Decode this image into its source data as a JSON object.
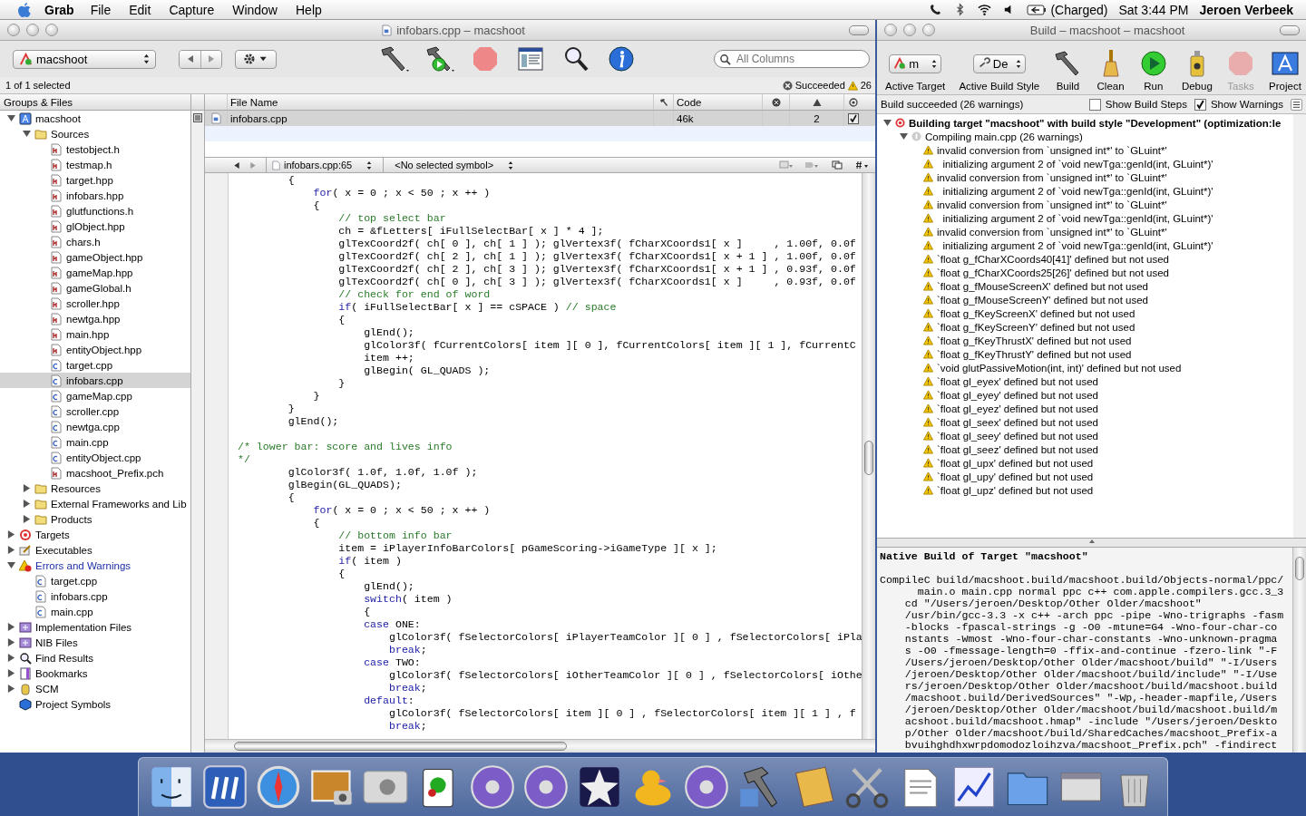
{
  "menu_bar": {
    "app_name": "Grab",
    "menus": [
      "File",
      "Edit",
      "Capture",
      "Window",
      "Help"
    ],
    "battery": "(Charged)",
    "clock": "Sat 3:44 PM",
    "user": "Jeroen Verbeek"
  },
  "project_window": {
    "title": "infobars.cpp – macshoot",
    "target_popup": "macshoot",
    "search": {
      "placeholder": "All Columns"
    },
    "selection_status": "1 of 1 selected",
    "build_status": "Succeeded",
    "warning_count": "26",
    "sidebar": {
      "header": "Groups & Files",
      "items": [
        {
          "label": "macshoot",
          "kind": "project",
          "expanded": true,
          "selected": false,
          "children": [
            {
              "label": "Sources",
              "kind": "folder",
              "expanded": true,
              "selected": false,
              "children": [
                {
                  "label": "testobject.h",
                  "kind": "header",
                  "selected": false
                },
                {
                  "label": "testmap.h",
                  "kind": "header",
                  "selected": false
                },
                {
                  "label": "target.hpp",
                  "kind": "header",
                  "selected": false
                },
                {
                  "label": "infobars.hpp",
                  "kind": "header",
                  "selected": false
                },
                {
                  "label": "glutfunctions.h",
                  "kind": "header",
                  "selected": false
                },
                {
                  "label": "glObject.hpp",
                  "kind": "header",
                  "selected": false
                },
                {
                  "label": "chars.h",
                  "kind": "header",
                  "selected": false
                },
                {
                  "label": "gameObject.hpp",
                  "kind": "header",
                  "selected": false
                },
                {
                  "label": "gameMap.hpp",
                  "kind": "header",
                  "selected": false
                },
                {
                  "label": "gameGlobal.h",
                  "kind": "header",
                  "selected": false
                },
                {
                  "label": "scroller.hpp",
                  "kind": "header",
                  "selected": false
                },
                {
                  "label": "newtga.hpp",
                  "kind": "header",
                  "selected": false
                },
                {
                  "label": "main.hpp",
                  "kind": "header",
                  "selected": false
                },
                {
                  "label": "entityObject.hpp",
                  "kind": "header",
                  "selected": false
                },
                {
                  "label": "target.cpp",
                  "kind": "cpp",
                  "selected": false
                },
                {
                  "label": "infobars.cpp",
                  "kind": "cpp",
                  "selected": true
                },
                {
                  "label": "gameMap.cpp",
                  "kind": "cpp",
                  "selected": false
                },
                {
                  "label": "scroller.cpp",
                  "kind": "cpp",
                  "selected": false
                },
                {
                  "label": "newtga.cpp",
                  "kind": "cpp",
                  "selected": false
                },
                {
                  "label": "main.cpp",
                  "kind": "cpp",
                  "selected": false
                },
                {
                  "label": "entityObject.cpp",
                  "kind": "cpp",
                  "selected": false
                },
                {
                  "label": "macshoot_Prefix.pch",
                  "kind": "header",
                  "selected": false
                }
              ]
            },
            {
              "label": "Resources",
              "kind": "folder",
              "expanded": false,
              "selected": false
            },
            {
              "label": "External Frameworks and Lib",
              "kind": "folder",
              "expanded": false,
              "selected": false
            },
            {
              "label": "Products",
              "kind": "folder",
              "expanded": false,
              "selected": false
            }
          ]
        },
        {
          "label": "Targets",
          "kind": "target",
          "expanded": false,
          "selected": false
        },
        {
          "label": "Executables",
          "kind": "executable",
          "expanded": false,
          "selected": false
        },
        {
          "label": "Errors and Warnings",
          "kind": "warning",
          "expanded": true,
          "selected": false,
          "children": [
            {
              "label": "target.cpp",
              "kind": "cpp",
              "selected": false
            },
            {
              "label": "infobars.cpp",
              "kind": "cpp",
              "selected": false
            },
            {
              "label": "main.cpp",
              "kind": "cpp",
              "selected": false
            }
          ]
        },
        {
          "label": "Implementation Files",
          "kind": "smart_group",
          "expanded": false,
          "selected": false
        },
        {
          "label": "NIB Files",
          "kind": "smart_group",
          "expanded": false,
          "selected": false
        },
        {
          "label": "Find Results",
          "kind": "find",
          "expanded": false,
          "selected": false
        },
        {
          "label": "Bookmarks",
          "kind": "bookmark",
          "expanded": false,
          "selected": false
        },
        {
          "label": "SCM",
          "kind": "scm",
          "expanded": false,
          "selected": false
        },
        {
          "label": "Project Symbols",
          "kind": "symbols",
          "selected": false
        }
      ]
    },
    "file_table": {
      "columns": [
        "File Name",
        "Code"
      ],
      "rows": [
        {
          "file": "infobars.cpp",
          "code": "46k",
          "warnings": "2",
          "checked": true,
          "selected": true
        }
      ]
    },
    "editor": {
      "file_position": "infobars.cpp:65",
      "symbol": "<No selected symbol>",
      "lines": [
        {
          "kind": "code",
          "segments": [
            {
              "kind": "plain",
              "text": "        {"
            }
          ]
        },
        {
          "kind": "code",
          "segments": [
            {
              "kind": "keyword",
              "text": "            for"
            },
            {
              "kind": "plain",
              "text": "( x = 0 ; x < 50 ; x ++ )"
            }
          ]
        },
        {
          "kind": "code",
          "segments": [
            {
              "kind": "plain",
              "text": "            {"
            }
          ]
        },
        {
          "kind": "code",
          "segments": [
            {
              "kind": "comment",
              "text": "                // top select bar"
            }
          ]
        },
        {
          "kind": "code",
          "segments": [
            {
              "kind": "plain",
              "text": "                ch = &fLetters[ iFullSelectBar[ x ] * 4 ];"
            }
          ]
        },
        {
          "kind": "code",
          "segments": [
            {
              "kind": "plain",
              "text": "                glTexCoord2f( ch[ 0 ], ch[ 1 ] ); glVertex3f( fCharXCoords1[ x ]     , 1.00f, 0.0f"
            }
          ]
        },
        {
          "kind": "code",
          "segments": [
            {
              "kind": "plain",
              "text": "                glTexCoord2f( ch[ 2 ], ch[ 1 ] ); glVertex3f( fCharXCoords1[ x + 1 ] , 1.00f, 0.0f"
            }
          ]
        },
        {
          "kind": "code",
          "segments": [
            {
              "kind": "plain",
              "text": "                glTexCoord2f( ch[ 2 ], ch[ 3 ] ); glVertex3f( fCharXCoords1[ x + 1 ] , 0.93f, 0.0f"
            }
          ]
        },
        {
          "kind": "code",
          "segments": [
            {
              "kind": "plain",
              "text": "                glTexCoord2f( ch[ 0 ], ch[ 3 ] ); glVertex3f( fCharXCoords1[ x ]     , 0.93f, 0.0f"
            }
          ]
        },
        {
          "kind": "code",
          "segments": [
            {
              "kind": "comment",
              "text": "                // check for end of word"
            }
          ]
        },
        {
          "kind": "code",
          "segments": [
            {
              "kind": "keyword",
              "text": "                if"
            },
            {
              "kind": "plain",
              "text": "( iFullSelectBar[ x ] == cSPACE ) "
            },
            {
              "kind": "comment",
              "text": "// space"
            }
          ]
        },
        {
          "kind": "code",
          "segments": [
            {
              "kind": "plain",
              "text": "                {"
            }
          ]
        },
        {
          "kind": "code",
          "segments": [
            {
              "kind": "plain",
              "text": "                    glEnd();"
            }
          ]
        },
        {
          "kind": "code",
          "segments": [
            {
              "kind": "plain",
              "text": "                    glColor3f( fCurrentColors[ item ][ 0 ], fCurrentColors[ item ][ 1 ], fCurrentC"
            }
          ]
        },
        {
          "kind": "code",
          "segments": [
            {
              "kind": "plain",
              "text": "                    item ++;"
            }
          ]
        },
        {
          "kind": "code",
          "segments": [
            {
              "kind": "plain",
              "text": "                    glBegin( GL_QUADS );"
            }
          ]
        },
        {
          "kind": "code",
          "segments": [
            {
              "kind": "plain",
              "text": "                }"
            }
          ]
        },
        {
          "kind": "code",
          "segments": [
            {
              "kind": "plain",
              "text": "            }"
            }
          ]
        },
        {
          "kind": "code",
          "segments": [
            {
              "kind": "plain",
              "text": "        }"
            }
          ]
        },
        {
          "kind": "code",
          "segments": [
            {
              "kind": "plain",
              "text": "        glEnd();"
            }
          ]
        },
        {
          "kind": "blank"
        },
        {
          "kind": "code",
          "segments": [
            {
              "kind": "comment",
              "text": "/* lower bar: score and lives info"
            }
          ]
        },
        {
          "kind": "code",
          "segments": [
            {
              "kind": "comment",
              "text": "*/"
            }
          ]
        },
        {
          "kind": "code",
          "segments": [
            {
              "kind": "plain",
              "text": "        glColor3f( 1.0f, 1.0f, 1.0f );"
            }
          ]
        },
        {
          "kind": "code",
          "segments": [
            {
              "kind": "plain",
              "text": "        glBegin(GL_QUADS);"
            }
          ]
        },
        {
          "kind": "code",
          "segments": [
            {
              "kind": "plain",
              "text": "        {"
            }
          ]
        },
        {
          "kind": "code",
          "segments": [
            {
              "kind": "keyword",
              "text": "            for"
            },
            {
              "kind": "plain",
              "text": "( x = 0 ; x < 50 ; x ++ )"
            }
          ]
        },
        {
          "kind": "code",
          "segments": [
            {
              "kind": "plain",
              "text": "            {"
            }
          ]
        },
        {
          "kind": "code",
          "segments": [
            {
              "kind": "comment",
              "text": "                // bottom info bar"
            }
          ]
        },
        {
          "kind": "code",
          "segments": [
            {
              "kind": "plain",
              "text": "                item = iPlayerInfoBarColors[ pGameScoring->iGameType ][ x ];"
            }
          ]
        },
        {
          "kind": "code",
          "segments": [
            {
              "kind": "keyword",
              "text": "                if"
            },
            {
              "kind": "plain",
              "text": "( item )"
            }
          ]
        },
        {
          "kind": "code",
          "segments": [
            {
              "kind": "plain",
              "text": "                {"
            }
          ]
        },
        {
          "kind": "code",
          "segments": [
            {
              "kind": "plain",
              "text": "                    glEnd();"
            }
          ]
        },
        {
          "kind": "code",
          "segments": [
            {
              "kind": "keyword",
              "text": "                    switch"
            },
            {
              "kind": "plain",
              "text": "( item )"
            }
          ]
        },
        {
          "kind": "code",
          "segments": [
            {
              "kind": "plain",
              "text": "                    {"
            }
          ]
        },
        {
          "kind": "code",
          "segments": [
            {
              "kind": "keyword",
              "text": "                    case"
            },
            {
              "kind": "plain",
              "text": " ONE:"
            }
          ]
        },
        {
          "kind": "code",
          "segments": [
            {
              "kind": "plain",
              "text": "                        glColor3f( fSelectorColors[ iPlayerTeamColor ][ 0 ] , fSelectorColors[ iPla"
            }
          ]
        },
        {
          "kind": "code",
          "segments": [
            {
              "kind": "keyword",
              "text": "                        break"
            },
            {
              "kind": "plain",
              "text": ";"
            }
          ]
        },
        {
          "kind": "code",
          "segments": [
            {
              "kind": "keyword",
              "text": "                    case"
            },
            {
              "kind": "plain",
              "text": " TWO:"
            }
          ]
        },
        {
          "kind": "code",
          "segments": [
            {
              "kind": "plain",
              "text": "                        glColor3f( fSelectorColors[ iOtherTeamColor ][ 0 ] , fSelectorColors[ iOthe"
            }
          ]
        },
        {
          "kind": "code",
          "segments": [
            {
              "kind": "keyword",
              "text": "                        break"
            },
            {
              "kind": "plain",
              "text": ";"
            }
          ]
        },
        {
          "kind": "code",
          "segments": [
            {
              "kind": "keyword",
              "text": "                    default"
            },
            {
              "kind": "plain",
              "text": ":"
            }
          ]
        },
        {
          "kind": "code",
          "segments": [
            {
              "kind": "plain",
              "text": "                        glColor3f( fSelectorColors[ item ][ 0 ] , fSelectorColors[ item ][ 1 ] , f"
            }
          ]
        },
        {
          "kind": "code",
          "segments": [
            {
              "kind": "keyword",
              "text": "                        break"
            },
            {
              "kind": "plain",
              "text": ";"
            }
          ]
        }
      ]
    }
  },
  "build_window": {
    "title": "Build – macshoot – macshoot",
    "toolbar": [
      {
        "kind": "target_popup",
        "label": "Active Target",
        "value": "m",
        "disabled": false
      },
      {
        "kind": "style_popup",
        "label": "Active Build Style",
        "value": "De",
        "disabled": false
      },
      {
        "kind": "build",
        "label": "Build",
        "disabled": false
      },
      {
        "kind": "clean",
        "label": "Clean",
        "disabled": false
      },
      {
        "kind": "run",
        "label": "Run",
        "disabled": false
      },
      {
        "kind": "debug",
        "label": "Debug",
        "disabled": false
      },
      {
        "kind": "tasks",
        "label": "Tasks",
        "disabled": true
      },
      {
        "kind": "project",
        "label": "Project",
        "disabled": false
      }
    ],
    "status": "Build succeeded (26 warnings)",
    "show_build_steps": {
      "label": "Show Build Steps",
      "checked": false
    },
    "show_warnings": {
      "label": "Show Warnings",
      "checked": true
    },
    "results": {
      "target": "Building target \"macshoot\" with build style \"Development\" (optimization:le",
      "target_expanded": true,
      "compile": "Compiling main.cpp (26 warnings)",
      "compile_expanded": true,
      "warnings": [
        "invalid conversion from `unsigned int*' to `GLuint*'",
        "  initializing argument 2 of `void newTga::genId(int, GLuint*)'",
        "invalid conversion from `unsigned int*' to `GLuint*'",
        "  initializing argument 2 of `void newTga::genId(int, GLuint*)'",
        "invalid conversion from `unsigned int*' to `GLuint*'",
        "  initializing argument 2 of `void newTga::genId(int, GLuint*)'",
        "invalid conversion from `unsigned int*' to `GLuint*'",
        "  initializing argument 2 of `void newTga::genId(int, GLuint*)'",
        "`float g_fCharXCoords40[41]' defined but not used",
        "`float g_fCharXCoords25[26]' defined but not used",
        "`float g_fMouseScreenX' defined but not used",
        "`float g_fMouseScreenY' defined but not used",
        "`float g_fKeyScreenX' defined but not used",
        "`float g_fKeyScreenY' defined but not used",
        "`float g_fKeyThrustX' defined but not used",
        "`float g_fKeyThrustY' defined but not used",
        "`void glutPassiveMotion(int, int)' defined but not used",
        "`float gl_eyex' defined but not used",
        "`float gl_eyey' defined but not used",
        "`float gl_eyez' defined but not used",
        "`float gl_seex' defined but not used",
        "`float gl_seey' defined but not used",
        "`float gl_seez' defined but not used",
        "`float gl_upx' defined but not used",
        "`float gl_upy' defined but not used",
        "`float gl_upz' defined but not used"
      ]
    },
    "log": {
      "heading": "Native Build of Target \"macshoot\"",
      "lines": [
        "CompileC build/macshoot.build/macshoot.build/Objects-normal/ppc/",
        "      main.o main.cpp normal ppc c++ com.apple.compilers.gcc.3_3",
        "    cd \"/Users/jeroen/Desktop/Other Older/macshoot\"",
        "    /usr/bin/gcc-3.3 -x c++ -arch ppc -pipe -Wno-trigraphs -fasm",
        "    -blocks -fpascal-strings -g -O0 -mtune=G4 -Wno-four-char-co",
        "    nstants -Wmost -Wno-four-char-constants -Wno-unknown-pragma",
        "    s -O0 -fmessage-length=0 -ffix-and-continue -fzero-link \"-F",
        "    /Users/jeroen/Desktop/Other Older/macshoot/build\" \"-I/Users",
        "    /jeroen/Desktop/Other Older/macshoot/build/include\" \"-I/Use",
        "    rs/jeroen/Desktop/Other Older/macshoot/build/macshoot.build",
        "    /macshoot.build/DerivedSources\" \"-Wp,-header-mapfile,/Users",
        "    /jeroen/Desktop/Other Older/macshoot/build/macshoot.build/m",
        "    acshoot.build/macshoot.hmap\" -include \"/Users/jeroen/Deskto",
        "    p/Other Older/macshoot/build/SharedCaches/macshoot_Prefix-a",
        "    bvuihghdhxwrpdomodozloihzva/macshoot_Prefix.pch\" -findirect"
      ]
    }
  }
}
